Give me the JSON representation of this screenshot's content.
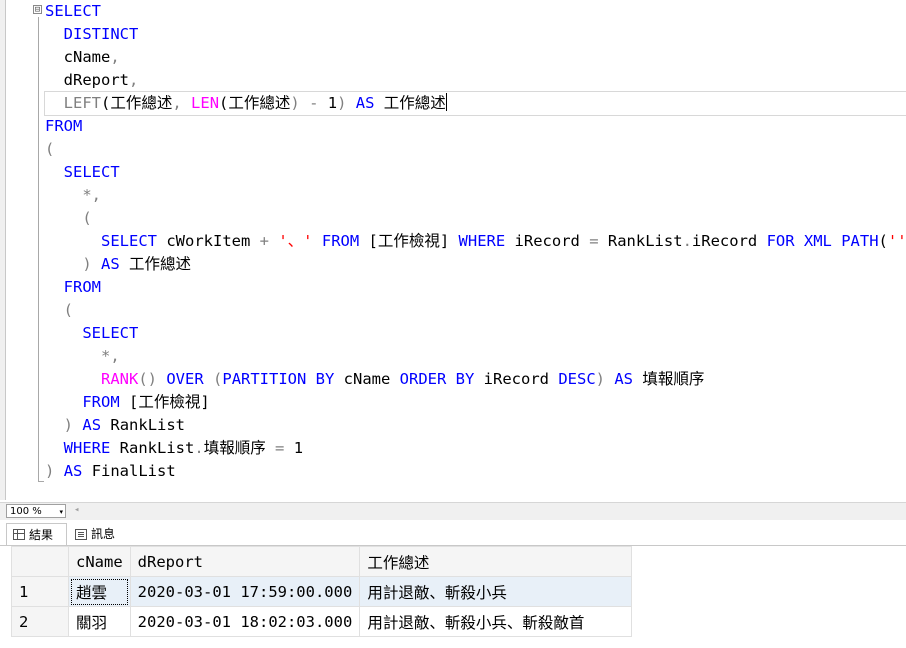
{
  "editor": {
    "collapse_glyph": "⊟",
    "lines": [
      [
        {
          "t": "SELECT",
          "c": "kw"
        }
      ],
      [
        {
          "t": "  "
        },
        {
          "t": "DISTINCT",
          "c": "kw"
        }
      ],
      [
        {
          "t": "  cName"
        },
        {
          "t": ",",
          "c": "op"
        }
      ],
      [
        {
          "t": "  dReport"
        },
        {
          "t": ",",
          "c": "op"
        }
      ],
      [
        {
          "t": "  "
        },
        {
          "t": "LEFT",
          "c": "op"
        },
        {
          "t": "("
        },
        {
          "t": "工作總述",
          "c": "cjk"
        },
        {
          "t": ", ",
          "c": "op"
        },
        {
          "t": "LEN",
          "c": "fn"
        },
        {
          "t": "("
        },
        {
          "t": "工作總述",
          "c": "cjk"
        },
        {
          "t": ")",
          "c": "op"
        },
        {
          "t": " - ",
          "c": "op"
        },
        {
          "t": "1"
        },
        {
          "t": ")",
          "c": "op"
        },
        {
          "t": " "
        },
        {
          "t": "AS",
          "c": "kw"
        },
        {
          "t": " "
        },
        {
          "t": "工作總述",
          "c": "cjk"
        }
      ],
      [
        {
          "t": "FROM",
          "c": "kw"
        }
      ],
      [
        {
          "t": "(",
          "c": "op"
        }
      ],
      [
        {
          "t": "  "
        },
        {
          "t": "SELECT",
          "c": "kw"
        }
      ],
      [
        {
          "t": "    "
        },
        {
          "t": "*,",
          "c": "op"
        }
      ],
      [
        {
          "t": "    "
        },
        {
          "t": "(",
          "c": "op"
        }
      ],
      [
        {
          "t": "      "
        },
        {
          "t": "SELECT",
          "c": "kw"
        },
        {
          "t": " cWorkItem "
        },
        {
          "t": "+",
          "c": "op"
        },
        {
          "t": " "
        },
        {
          "t": "'、'",
          "c": "str"
        },
        {
          "t": " "
        },
        {
          "t": "FROM",
          "c": "kw"
        },
        {
          "t": " ["
        },
        {
          "t": "工作檢視",
          "c": "cjk"
        },
        {
          "t": "] "
        },
        {
          "t": "WHERE",
          "c": "kw"
        },
        {
          "t": " iRecord "
        },
        {
          "t": "=",
          "c": "op"
        },
        {
          "t": " RankList"
        },
        {
          "t": ".",
          "c": "op"
        },
        {
          "t": "iRecord "
        },
        {
          "t": "FOR XML PATH",
          "c": "kw"
        },
        {
          "t": "("
        },
        {
          "t": "''",
          "c": "str"
        },
        {
          "t": ")",
          "c": "op"
        }
      ],
      [
        {
          "t": "    "
        },
        {
          "t": ")",
          "c": "op"
        },
        {
          "t": " "
        },
        {
          "t": "AS",
          "c": "kw"
        },
        {
          "t": " "
        },
        {
          "t": "工作總述",
          "c": "cjk"
        }
      ],
      [
        {
          "t": "  "
        },
        {
          "t": "FROM",
          "c": "kw"
        }
      ],
      [
        {
          "t": "  "
        },
        {
          "t": "(",
          "c": "op"
        }
      ],
      [
        {
          "t": "    "
        },
        {
          "t": "SELECT",
          "c": "kw"
        }
      ],
      [
        {
          "t": "      "
        },
        {
          "t": "*,",
          "c": "op"
        }
      ],
      [
        {
          "t": "      "
        },
        {
          "t": "RANK",
          "c": "fn"
        },
        {
          "t": "()",
          "c": "op"
        },
        {
          "t": " "
        },
        {
          "t": "OVER",
          "c": "kw"
        },
        {
          "t": " "
        },
        {
          "t": "(",
          "c": "op"
        },
        {
          "t": "PARTITION BY",
          "c": "kw"
        },
        {
          "t": " cName "
        },
        {
          "t": "ORDER BY",
          "c": "kw"
        },
        {
          "t": " iRecord "
        },
        {
          "t": "DESC",
          "c": "kw"
        },
        {
          "t": ")",
          "c": "op"
        },
        {
          "t": " "
        },
        {
          "t": "AS",
          "c": "kw"
        },
        {
          "t": " "
        },
        {
          "t": "填報順序",
          "c": "cjk"
        }
      ],
      [
        {
          "t": "    "
        },
        {
          "t": "FROM",
          "c": "kw"
        },
        {
          "t": " ["
        },
        {
          "t": "工作檢視",
          "c": "cjk"
        },
        {
          "t": "]"
        }
      ],
      [
        {
          "t": "  "
        },
        {
          "t": ")",
          "c": "op"
        },
        {
          "t": " "
        },
        {
          "t": "AS",
          "c": "kw"
        },
        {
          "t": " RankList"
        }
      ],
      [
        {
          "t": "  "
        },
        {
          "t": "WHERE",
          "c": "kw"
        },
        {
          "t": " RankList"
        },
        {
          "t": ".",
          "c": "op"
        },
        {
          "t": "填報順序",
          "c": "cjk"
        },
        {
          "t": " "
        },
        {
          "t": "=",
          "c": "op"
        },
        {
          "t": " 1"
        }
      ],
      [
        {
          "t": ")",
          "c": "op"
        },
        {
          "t": " "
        },
        {
          "t": "AS",
          "c": "kw"
        },
        {
          "t": " FinalList"
        }
      ]
    ]
  },
  "toolbar": {
    "zoom": "100 %",
    "zoom_arrow": "▾",
    "scroll_left": "◂"
  },
  "tabs": [
    {
      "label": "結果"
    },
    {
      "label": "訊息"
    }
  ],
  "results": {
    "columns": [
      "cName",
      "dReport",
      "工作總述"
    ],
    "rows": [
      {
        "num": "1",
        "cName": "趙雲",
        "dReport": "2020-03-01 17:59:00.000",
        "summary": "用計退敵、斬殺小兵"
      },
      {
        "num": "2",
        "cName": "關羽",
        "dReport": "2020-03-01 18:02:03.000",
        "summary": "用計退敵、斬殺小兵、斬殺敵首"
      }
    ]
  }
}
